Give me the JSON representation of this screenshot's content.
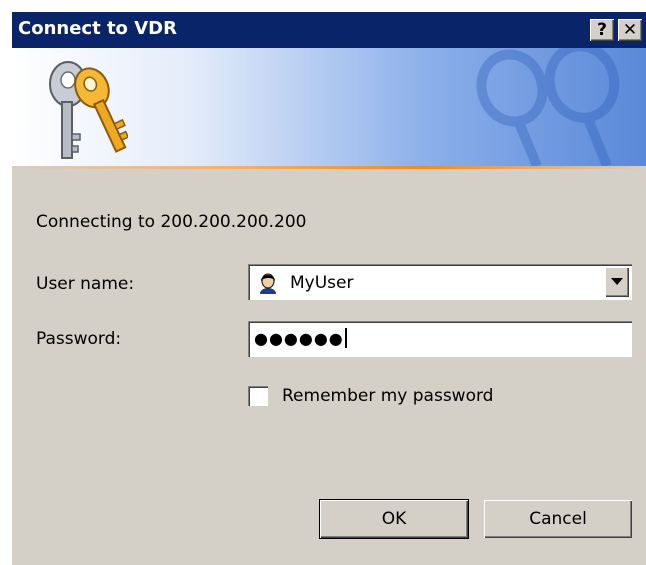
{
  "window": {
    "title": "Connect to VDR",
    "help_label": "?",
    "close_label": "✕"
  },
  "banner": {
    "icon": "keys-icon",
    "watermark": "keys-watermark-icon"
  },
  "form": {
    "connecting_text": "Connecting to 200.200.200.200",
    "user_label": "User name:",
    "user_value": "MyUser",
    "user_icon": "user-icon",
    "password_label": "Password:",
    "password_masked": "●●●●●●",
    "remember_label": "Remember my password",
    "remember_checked": false
  },
  "buttons": {
    "ok": "OK",
    "cancel": "Cancel"
  },
  "colors": {
    "titlebar": "#0a246a",
    "dialog_bg": "#d4d0c8",
    "accent_orange": "#f08a20"
  }
}
